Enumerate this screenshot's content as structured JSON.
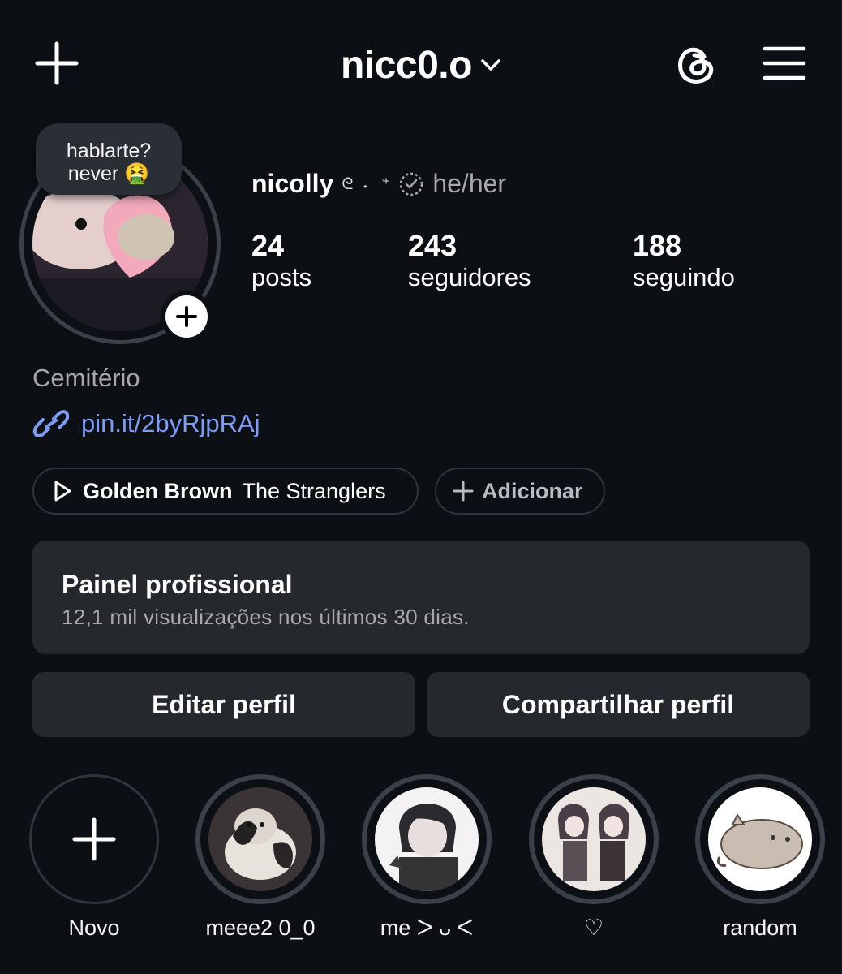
{
  "header": {
    "username": "nicc0.o",
    "icons": {
      "create": "plus-icon",
      "threads": "threads-icon",
      "menu": "hamburger-menu-icon",
      "switch": "chevron-down-icon"
    }
  },
  "profile": {
    "note": "hablarte?\nnever 🤮",
    "display_name": "nicolly",
    "decoration": "ᘓ ˖ ݁ ⁺",
    "pronouns": "he/her",
    "stats": [
      {
        "value": "24",
        "label": "posts"
      },
      {
        "value": "243",
        "label": "seguidores"
      },
      {
        "value": "188",
        "label": "seguindo"
      }
    ],
    "category": "Cemitério",
    "link": "pin.it/2byRjpRAj"
  },
  "music": {
    "song": "Golden Brown",
    "artist": "The Stranglers",
    "add_label": "Adicionar"
  },
  "dashboard": {
    "title": "Painel profissional",
    "subtitle": "12,1 mil visualizações nos últimos 30 dias."
  },
  "actions": {
    "edit": "Editar perfil",
    "share": "Compartilhar perfil"
  },
  "highlights": [
    {
      "label": "Novo"
    },
    {
      "label": "meee2 0_0"
    },
    {
      "label": "me ᐳ ᴗ ᐸ"
    },
    {
      "label": "♡"
    },
    {
      "label": "random"
    }
  ],
  "colors": {
    "background": "#0c1014",
    "surface": "#25292e",
    "link": "#7e9cf6",
    "muted": "#a8a8a8"
  }
}
